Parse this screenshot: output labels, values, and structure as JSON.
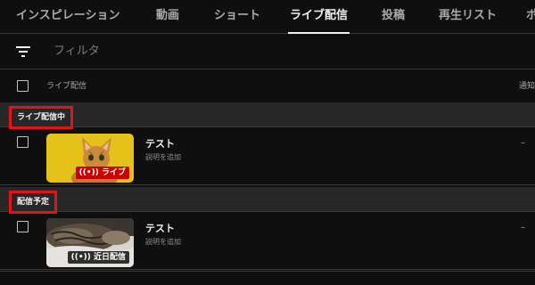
{
  "tabs": [
    {
      "label": "インスピレーション",
      "active": false
    },
    {
      "label": "動画",
      "active": false
    },
    {
      "label": "ショート",
      "active": false
    },
    {
      "label": "ライブ配信",
      "active": true
    },
    {
      "label": "投稿",
      "active": false
    },
    {
      "label": "再生リスト",
      "active": false
    },
    {
      "label": "ポ",
      "active": false
    }
  ],
  "filter": {
    "icon": "filter-icon",
    "placeholder": "フィルタ"
  },
  "table_header": {
    "column_label": "ライブ配信",
    "right_column_label": "通知"
  },
  "sections": [
    {
      "label": "ライブ配信中",
      "rows": [
        {
          "title": "テスト",
          "description": "説明を追加",
          "badge": "ライブ",
          "badge_icon": "live-broadcast-icon",
          "badge_color": "#cc0000",
          "right_value": "–",
          "thumbnail": "kitten-on-yellow"
        }
      ]
    },
    {
      "label": "配信予定",
      "rows": [
        {
          "title": "テスト",
          "description": "説明を追加",
          "badge": "近日配信",
          "badge_icon": "live-broadcast-icon",
          "badge_color": "#000000",
          "right_value": "–",
          "thumbnail": "cat-sleeping"
        }
      ]
    }
  ],
  "colors": {
    "background": "#0f0f0f",
    "section_bg": "#272727",
    "highlight_box": "#e0141a",
    "live_red": "#cc0000"
  }
}
